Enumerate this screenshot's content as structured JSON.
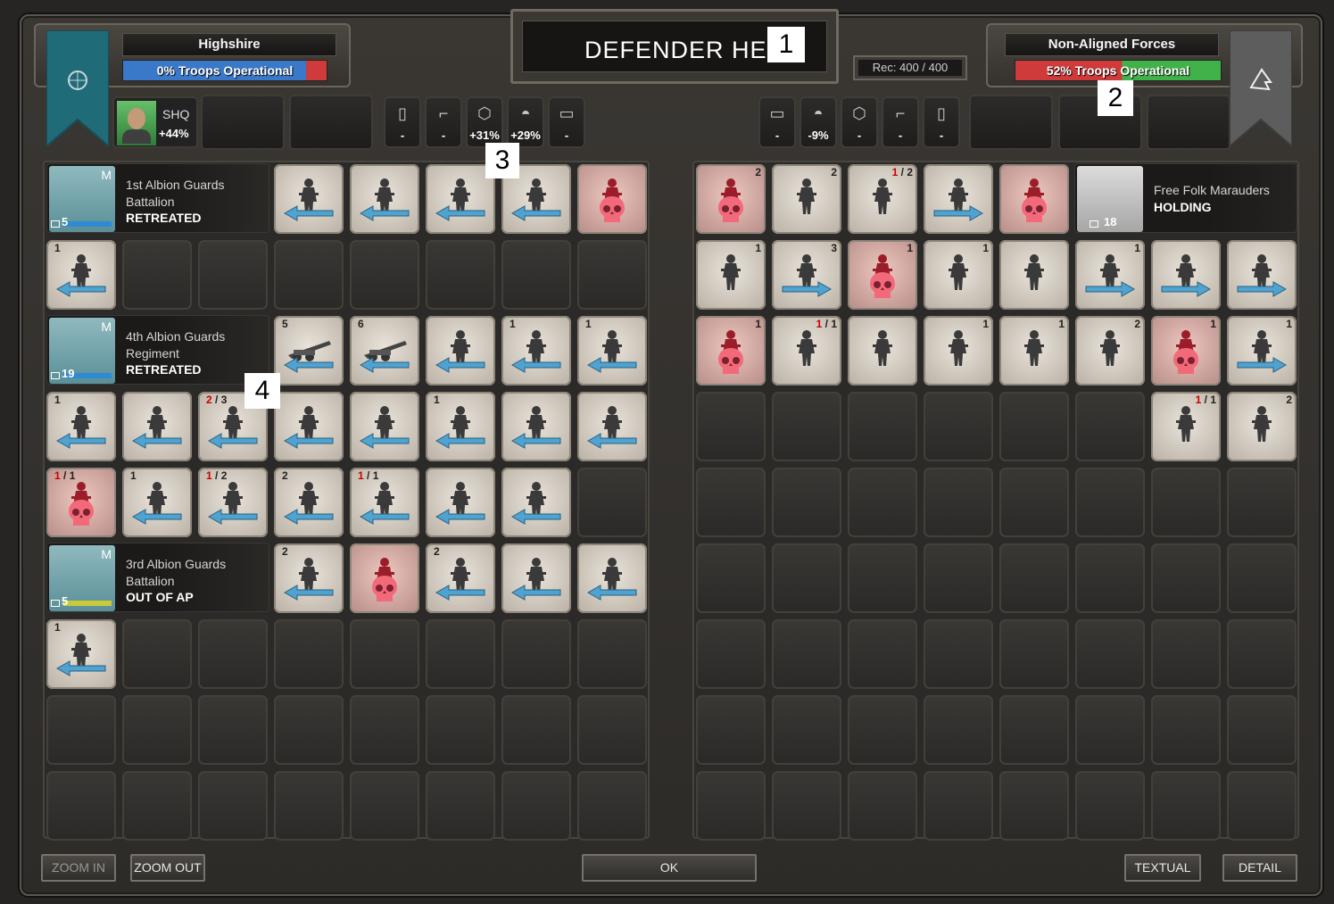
{
  "result_title": "DEFENDER HELD",
  "markers": [
    "1",
    "2",
    "3",
    "4"
  ],
  "left": {
    "faction": "Highshire",
    "operational": "0% Troops Operational",
    "operational_fraction": 0.0,
    "shq_label": "SHQ",
    "shq_bonus": "+44%",
    "mods": [
      {
        "icon": "cards-icon",
        "value": "-"
      },
      {
        "icon": "pistol-icon",
        "value": "-"
      },
      {
        "icon": "hexagon-icon",
        "value": "+31%"
      },
      {
        "icon": "helmet-icon",
        "value": "+29%"
      },
      {
        "icon": "barrel-icon",
        "value": "-"
      }
    ]
  },
  "right": {
    "faction": "Non-Aligned Forces",
    "operational": "52% Troops Operational",
    "operational_fraction": 0.52,
    "recruit": "Rec: 400 / 400",
    "mods": [
      {
        "icon": "barrel-icon",
        "value": "-"
      },
      {
        "icon": "helmet-icon",
        "value": "-9%"
      },
      {
        "icon": "hexagon-icon",
        "value": "-"
      },
      {
        "icon": "pistol-icon",
        "value": "-"
      },
      {
        "icon": "cards-icon",
        "value": "-"
      }
    ]
  },
  "left_hqs": [
    {
      "name": "1st Albion Guards Battalion",
      "status": "RETREATED",
      "count": "5",
      "mark": "M"
    },
    {
      "name": "4th Albion Guards Regiment",
      "status": "RETREATED",
      "count": "19",
      "mark": "M"
    },
    {
      "name": "3rd Albion Guards Battalion",
      "status": "OUT OF AP",
      "count": "5",
      "mark": "M"
    }
  ],
  "right_hq": {
    "name": "Free Folk Marauders",
    "status": "HOLDING",
    "count": "18"
  },
  "left_units": [
    {
      "r": 0,
      "c": 3,
      "t": "a"
    },
    {
      "r": 0,
      "c": 4,
      "t": "a"
    },
    {
      "r": 0,
      "c": 5,
      "t": "a"
    },
    {
      "r": 0,
      "c": 6,
      "t": "a"
    },
    {
      "r": 0,
      "c": 7,
      "t": "d"
    },
    {
      "r": 1,
      "c": 0,
      "t": "a",
      "n": "1",
      "g": 1
    },
    {
      "r": 2,
      "c": 3,
      "t": "a",
      "n": "5",
      "k": "gun"
    },
    {
      "r": 2,
      "c": 4,
      "t": "a",
      "n": "6",
      "k": "gun"
    },
    {
      "r": 2,
      "c": 5,
      "t": "a"
    },
    {
      "r": 2,
      "c": 6,
      "t": "a",
      "n": "1"
    },
    {
      "r": 2,
      "c": 7,
      "t": "a",
      "n": "1"
    },
    {
      "r": 3,
      "c": 0,
      "t": "a",
      "n": "1"
    },
    {
      "r": 3,
      "c": 1,
      "t": "a"
    },
    {
      "r": 3,
      "c": 2,
      "t": "a",
      "red": "2",
      "n": "3"
    },
    {
      "r": 3,
      "c": 3,
      "t": "a"
    },
    {
      "r": 3,
      "c": 4,
      "t": "a"
    },
    {
      "r": 3,
      "c": 5,
      "t": "a",
      "n": "1"
    },
    {
      "r": 3,
      "c": 6,
      "t": "a"
    },
    {
      "r": 3,
      "c": 7,
      "t": "a"
    },
    {
      "r": 4,
      "c": 0,
      "t": "d",
      "red": "1",
      "n": "1"
    },
    {
      "r": 4,
      "c": 1,
      "t": "a",
      "n": "1"
    },
    {
      "r": 4,
      "c": 2,
      "t": "a",
      "red": "1",
      "n": "2"
    },
    {
      "r": 4,
      "c": 3,
      "t": "a",
      "n": "2"
    },
    {
      "r": 4,
      "c": 4,
      "t": "a",
      "red": "1",
      "n": "1"
    },
    {
      "r": 4,
      "c": 5,
      "t": "a"
    },
    {
      "r": 4,
      "c": 6,
      "t": "a"
    },
    {
      "r": 5,
      "c": 3,
      "t": "a",
      "n": "2"
    },
    {
      "r": 5,
      "c": 4,
      "t": "d"
    },
    {
      "r": 5,
      "c": 5,
      "t": "a",
      "n": "2"
    },
    {
      "r": 5,
      "c": 6,
      "t": "a"
    },
    {
      "r": 5,
      "c": 7,
      "t": "a"
    },
    {
      "r": 6,
      "c": 0,
      "t": "a",
      "n": "1"
    }
  ],
  "right_units": [
    {
      "r": 0,
      "c": 0,
      "t": "d",
      "n": "2"
    },
    {
      "r": 0,
      "c": 1,
      "t": "n",
      "n": "2"
    },
    {
      "r": 0,
      "c": 2,
      "t": "n",
      "red": "1",
      "n": "2"
    },
    {
      "r": 0,
      "c": 3,
      "t": "a"
    },
    {
      "r": 0,
      "c": 4,
      "t": "d"
    },
    {
      "r": 1,
      "c": 0,
      "t": "n",
      "n": "1"
    },
    {
      "r": 1,
      "c": 1,
      "t": "a",
      "n": "3"
    },
    {
      "r": 1,
      "c": 2,
      "t": "d",
      "n": "1"
    },
    {
      "r": 1,
      "c": 3,
      "t": "n",
      "n": "1"
    },
    {
      "r": 1,
      "c": 4,
      "t": "n"
    },
    {
      "r": 1,
      "c": 5,
      "t": "a",
      "n": "1"
    },
    {
      "r": 1,
      "c": 6,
      "t": "a"
    },
    {
      "r": 1,
      "c": 7,
      "t": "a"
    },
    {
      "r": 2,
      "c": 0,
      "t": "d",
      "n": "1"
    },
    {
      "r": 2,
      "c": 1,
      "t": "n",
      "red": "1",
      "n": "1"
    },
    {
      "r": 2,
      "c": 2,
      "t": "n"
    },
    {
      "r": 2,
      "c": 3,
      "t": "n",
      "n": "1"
    },
    {
      "r": 2,
      "c": 4,
      "t": "n",
      "n": "1"
    },
    {
      "r": 2,
      "c": 5,
      "t": "n",
      "n": "2"
    },
    {
      "r": 2,
      "c": 6,
      "t": "d",
      "n": "1"
    },
    {
      "r": 2,
      "c": 7,
      "t": "a",
      "n": "1"
    },
    {
      "r": 3,
      "c": 6,
      "t": "n",
      "red": "1",
      "n": "1"
    },
    {
      "r": 3,
      "c": 7,
      "t": "n",
      "n": "2"
    }
  ],
  "buttons": {
    "zoom_in": "ZOOM IN",
    "zoom_out": "ZOOM OUT",
    "ok": "OK",
    "textual": "TEXTUAL",
    "detail": "DETAIL"
  },
  "colors": {
    "blue_arrow": "#4fa3d1",
    "ops_blue": "#3a79c9",
    "ops_red": "#cf3a3a",
    "ops_green": "#41b24a",
    "skull": "#f26a79"
  }
}
